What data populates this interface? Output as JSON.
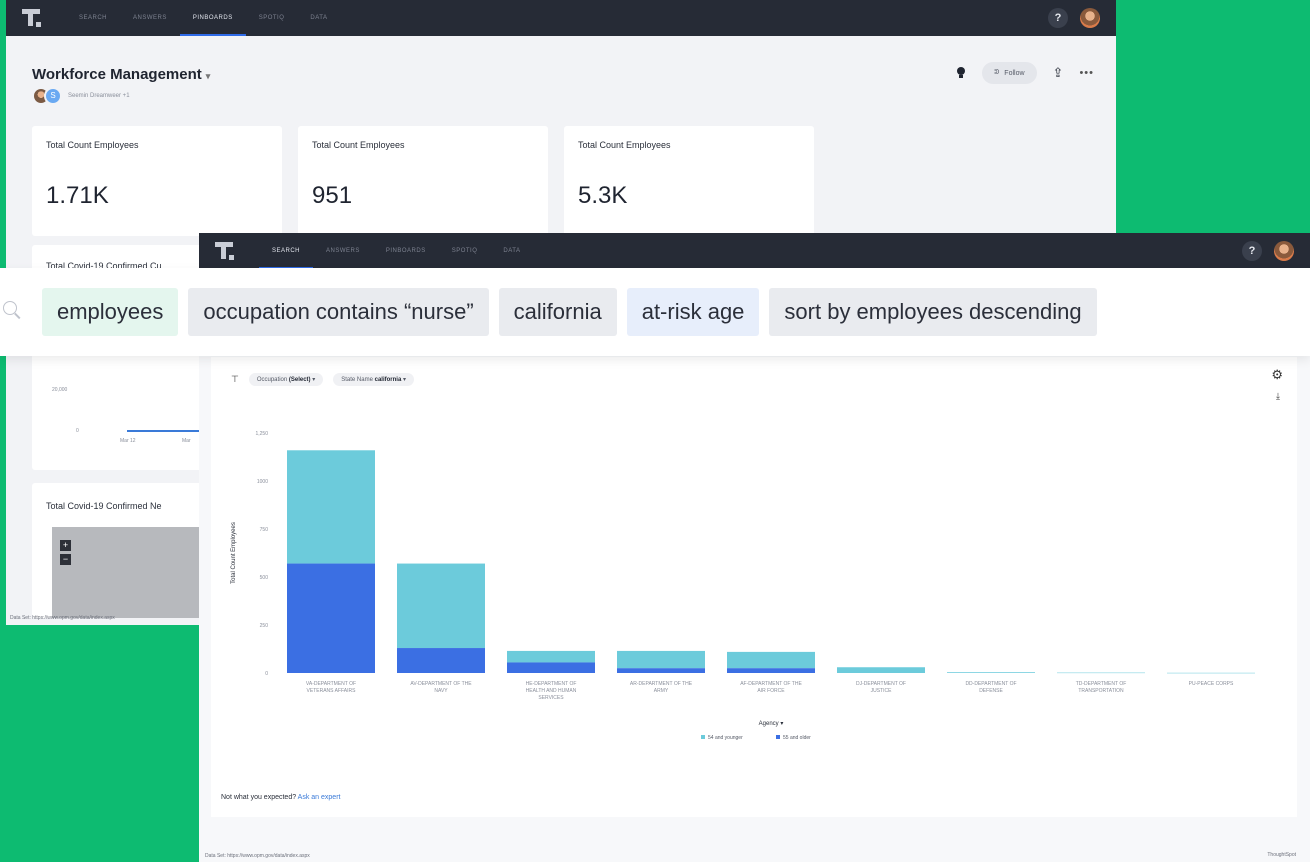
{
  "back_window": {
    "nav_tabs": [
      "SEARCH",
      "ANSWERS",
      "PINBOARDS",
      "SPOTIQ",
      "DATA"
    ],
    "active_tab": 2,
    "help_label": "?",
    "title": "Workforce Management",
    "title_caret": "▾",
    "author_initial": "S",
    "authors_text": "Seemin Dreamweer +1",
    "follow_label": "Follow",
    "kpis": [
      {
        "label": "Total Count Employees",
        "value": "1.71K"
      },
      {
        "label": "Total Count Employees",
        "value": "951"
      },
      {
        "label": "Total Count Employees",
        "value": "5.3K"
      }
    ],
    "card2_title": "Total Covid-19 Confirmed Cu",
    "card2_ticks": [
      "20,000",
      "0"
    ],
    "card2_xticks": [
      "Mar 12",
      "Mar"
    ],
    "card3_title": "Total Covid-19 Confirmed Ne",
    "map_plus": "+",
    "map_minus": "−",
    "data_table": "Data Set: https://www.opm.gov/data/index.aspx"
  },
  "front_window": {
    "nav_tabs": [
      "SEARCH",
      "ANSWERS",
      "PINBOARDS",
      "SPOTIQ",
      "DATA"
    ],
    "active_tab": 0,
    "help_label": "?",
    "filters": [
      {
        "label": "Occupation",
        "value": "(Select)"
      },
      {
        "label": "State Name",
        "value": "california"
      }
    ],
    "not_expected": "Not what you expected?",
    "ask_expert": "Ask an expert",
    "data_table": "Data Set: https://www.opm.gov/data/index.aspx",
    "brand": "ThoughtSpot"
  },
  "search": {
    "tokens": [
      {
        "text": "employees",
        "kind": "measure"
      },
      {
        "text": "occupation contains “nurse”",
        "kind": "filter"
      },
      {
        "text": "california",
        "kind": "filter"
      },
      {
        "text": "at-risk age",
        "kind": "attr"
      },
      {
        "text": "sort by employees descending",
        "kind": "filter"
      }
    ]
  },
  "colors": {
    "under_55": "#6ccbdb",
    "over_55": "#3b6fe3",
    "brand_green": "#0dbb71"
  },
  "chart_data": {
    "type": "bar",
    "stacked": true,
    "categories": [
      "VA-DEPARTMENT OF VETERANS AFFAIRS",
      "AV-DEPARTMENT OF THE NAVY",
      "HE-DEPARTMENT OF HEALTH AND HUMAN SERVICES",
      "AR-DEPARTMENT OF THE ARMY",
      "AF-DEPARTMENT OF THE AIR FORCE",
      "DJ-DEPARTMENT OF JUSTICE",
      "DD-DEPARTMENT OF DEFENSE",
      "TD-DEPARTMENT OF TRANSPORTATION",
      "PU-PEACE CORPS"
    ],
    "series": [
      {
        "name": "55 and older",
        "values": [
          570,
          130,
          55,
          25,
          25,
          0,
          0,
          0,
          0
        ]
      },
      {
        "name": "54 and younger",
        "values": [
          590,
          440,
          60,
          90,
          85,
          30,
          4,
          2,
          1
        ]
      }
    ],
    "ylim": [
      0,
      1250
    ],
    "yticks": [
      0,
      250,
      500,
      750,
      1000,
      1250
    ],
    "ytick_labels": [
      "0",
      "250",
      "500",
      "750",
      "1000",
      "1,250"
    ],
    "xlabel": "Agency",
    "ylabel": "Total Count Employees",
    "legend_position": "bottom",
    "legend": [
      "54 and younger",
      "55 and older"
    ]
  }
}
